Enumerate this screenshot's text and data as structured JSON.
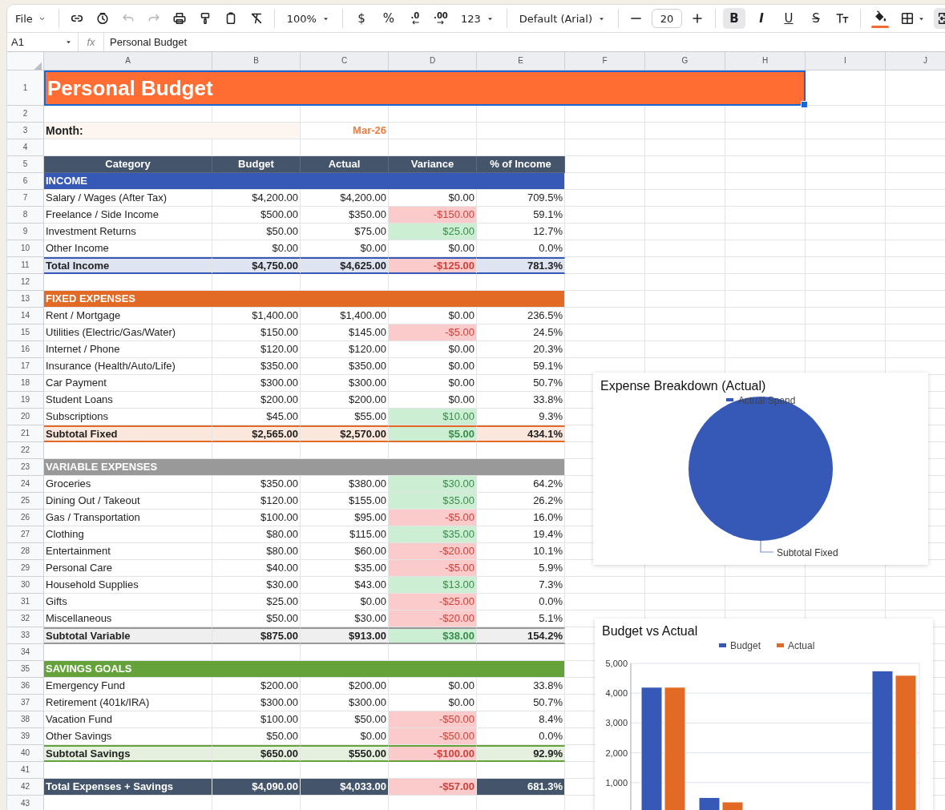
{
  "toolbar": [
    [
      {
        "kind": "file-menu",
        "label": "File"
      }
    ],
    [
      {
        "kind": "link",
        "disabled": false
      },
      {
        "kind": "history",
        "disabled": false
      },
      {
        "kind": "undo",
        "disabled": true
      },
      {
        "kind": "redo",
        "disabled": true
      },
      {
        "kind": "print",
        "disabled": false
      },
      {
        "kind": "paint-format",
        "disabled": false
      },
      {
        "kind": "paste",
        "disabled": false
      },
      {
        "kind": "clear-format",
        "disabled": false
      }
    ],
    [
      {
        "kind": "dropdown",
        "label": "100%"
      }
    ],
    [
      {
        "kind": "text",
        "label": "$"
      },
      {
        "kind": "text",
        "label": "%"
      },
      {
        "kind": "decimal-decrease",
        "label": ".0"
      },
      {
        "kind": "decimal-increase",
        "label": ".00"
      },
      {
        "kind": "dropdown",
        "label": "123"
      }
    ],
    [
      {
        "kind": "dropdown",
        "label": "Default (Arial)"
      }
    ],
    [
      {
        "kind": "minus"
      },
      {
        "kind": "field",
        "value": "20"
      },
      {
        "kind": "plus"
      }
    ],
    [
      {
        "kind": "bold",
        "label": "B",
        "selected": true
      },
      {
        "kind": "italic",
        "label": "I",
        "selected": false
      },
      {
        "kind": "underline",
        "label": "U",
        "selected": false
      },
      {
        "kind": "strike",
        "label": "S",
        "selected": false
      },
      {
        "kind": "text-size",
        "selected": false
      }
    ],
    [
      {
        "kind": "fill",
        "color": "#f26b2e",
        "selected": false
      },
      {
        "kind": "borders",
        "selected": false
      },
      {
        "kind": "merge",
        "selected": true
      }
    ]
  ],
  "formula_bar": {
    "cell_ref": "A1",
    "fx": "fx",
    "content": "Personal Budget"
  },
  "columns": [
    "A",
    "B",
    "C",
    "D",
    "E",
    "F",
    "G",
    "H",
    "I",
    "J"
  ],
  "rows": [
    {
      "kind": "title",
      "number": "1",
      "text": "Personal Budget",
      "selected": true
    },
    {
      "kind": "blank",
      "number": "2"
    },
    {
      "kind": "month",
      "number": "3",
      "label": "Month:",
      "value": "Mar-26"
    },
    {
      "kind": "blank",
      "number": "4"
    },
    {
      "kind": "header",
      "number": "5",
      "cells": [
        "Category",
        "Budget",
        "Actual",
        "Variance",
        "% of Income"
      ]
    },
    {
      "kind": "section",
      "number": "6",
      "label": "INCOME",
      "color": "#3659b7"
    },
    {
      "kind": "item",
      "number": "7",
      "category": "Salary / Wages (After Tax)",
      "budget": "$4,200.00",
      "actual": "$4,200.00",
      "variance": "$0.00",
      "negative": false,
      "positive": false,
      "percent": "709.5%"
    },
    {
      "kind": "item",
      "number": "8",
      "category": "Freelance / Side Income",
      "budget": "$500.00",
      "actual": "$350.00",
      "variance": "-$150.00",
      "negative": true,
      "positive": false,
      "percent": "59.1%"
    },
    {
      "kind": "item",
      "number": "9",
      "category": "Investment Returns",
      "budget": "$50.00",
      "actual": "$75.00",
      "variance": "$25.00",
      "negative": false,
      "positive": true,
      "percent": "12.7%"
    },
    {
      "kind": "item",
      "number": "10",
      "category": "Other Income",
      "budget": "$0.00",
      "actual": "$0.00",
      "variance": "$0.00",
      "negative": false,
      "positive": false,
      "percent": "0.0%"
    },
    {
      "kind": "total",
      "number": "11",
      "category": "Total Income",
      "budget": "$4,750.00",
      "actual": "$4,625.00",
      "variance": "-$125.00",
      "negative": true,
      "positive": false,
      "percent": "781.3%",
      "color": "#3659b7"
    },
    {
      "kind": "blank",
      "number": "12"
    },
    {
      "kind": "section",
      "number": "13",
      "label": "FIXED EXPENSES",
      "color": "#e36a25"
    },
    {
      "kind": "item",
      "number": "14",
      "category": "Rent / Mortgage",
      "budget": "$1,400.00",
      "actual": "$1,400.00",
      "variance": "$0.00",
      "negative": false,
      "positive": false,
      "percent": "236.5%"
    },
    {
      "kind": "item",
      "number": "15",
      "category": "Utilities (Electric/Gas/Water)",
      "budget": "$150.00",
      "actual": "$145.00",
      "variance": "-$5.00",
      "negative": true,
      "positive": false,
      "percent": "24.5%"
    },
    {
      "kind": "item",
      "number": "16",
      "category": "Internet / Phone",
      "budget": "$120.00",
      "actual": "$120.00",
      "variance": "$0.00",
      "negative": false,
      "positive": false,
      "percent": "20.3%"
    },
    {
      "kind": "item",
      "number": "17",
      "category": "Insurance (Health/Auto/Life)",
      "budget": "$350.00",
      "actual": "$350.00",
      "variance": "$0.00",
      "negative": false,
      "positive": false,
      "percent": "59.1%"
    },
    {
      "kind": "item",
      "number": "18",
      "category": "Car Payment",
      "budget": "$300.00",
      "actual": "$300.00",
      "variance": "$0.00",
      "negative": false,
      "positive": false,
      "percent": "50.7%"
    },
    {
      "kind": "item",
      "number": "19",
      "category": "Student Loans",
      "budget": "$200.00",
      "actual": "$200.00",
      "variance": "$0.00",
      "negative": false,
      "positive": false,
      "percent": "33.8%"
    },
    {
      "kind": "item",
      "number": "20",
      "category": "Subscriptions",
      "budget": "$45.00",
      "actual": "$55.00",
      "variance": "$10.00",
      "negative": false,
      "positive": true,
      "percent": "9.3%"
    },
    {
      "kind": "total",
      "number": "21",
      "category": "Subtotal Fixed",
      "budget": "$2,565.00",
      "actual": "$2,570.00",
      "variance": "$5.00",
      "negative": false,
      "positive": true,
      "percent": "434.1%",
      "color": "#e36a25"
    },
    {
      "kind": "blank",
      "number": "22"
    },
    {
      "kind": "section",
      "number": "23",
      "label": "VARIABLE EXPENSES",
      "color": "#999999"
    },
    {
      "kind": "item",
      "number": "24",
      "category": "Groceries",
      "budget": "$350.00",
      "actual": "$380.00",
      "variance": "$30.00",
      "negative": false,
      "positive": true,
      "percent": "64.2%"
    },
    {
      "kind": "item",
      "number": "25",
      "category": "Dining Out / Takeout",
      "budget": "$120.00",
      "actual": "$155.00",
      "variance": "$35.00",
      "negative": false,
      "positive": true,
      "percent": "26.2%"
    },
    {
      "kind": "item",
      "number": "26",
      "category": "Gas / Transportation",
      "budget": "$100.00",
      "actual": "$95.00",
      "variance": "-$5.00",
      "negative": true,
      "positive": false,
      "percent": "16.0%"
    },
    {
      "kind": "item",
      "number": "27",
      "category": "Clothing",
      "budget": "$80.00",
      "actual": "$115.00",
      "variance": "$35.00",
      "negative": false,
      "positive": true,
      "percent": "19.4%"
    },
    {
      "kind": "item",
      "number": "28",
      "category": "Entertainment",
      "budget": "$80.00",
      "actual": "$60.00",
      "variance": "-$20.00",
      "negative": true,
      "positive": false,
      "percent": "10.1%"
    },
    {
      "kind": "item",
      "number": "29",
      "category": "Personal Care",
      "budget": "$40.00",
      "actual": "$35.00",
      "variance": "-$5.00",
      "negative": true,
      "positive": false,
      "percent": "5.9%"
    },
    {
      "kind": "item",
      "number": "30",
      "category": "Household Supplies",
      "budget": "$30.00",
      "actual": "$43.00",
      "variance": "$13.00",
      "negative": false,
      "positive": true,
      "percent": "7.3%"
    },
    {
      "kind": "item",
      "number": "31",
      "category": "Gifts",
      "budget": "$25.00",
      "actual": "$0.00",
      "variance": "-$25.00",
      "negative": true,
      "positive": false,
      "percent": "0.0%"
    },
    {
      "kind": "item",
      "number": "32",
      "category": "Miscellaneous",
      "budget": "$50.00",
      "actual": "$30.00",
      "variance": "-$20.00",
      "negative": true,
      "positive": false,
      "percent": "5.1%"
    },
    {
      "kind": "total",
      "number": "33",
      "category": "Subtotal Variable",
      "budget": "$875.00",
      "actual": "$913.00",
      "variance": "$38.00",
      "negative": false,
      "positive": true,
      "percent": "154.2%",
      "color": "#999999"
    },
    {
      "kind": "blank",
      "number": "34"
    },
    {
      "kind": "section",
      "number": "35",
      "label": "SAVINGS GOALS",
      "color": "#65a33a"
    },
    {
      "kind": "item",
      "number": "36",
      "category": "Emergency Fund",
      "budget": "$200.00",
      "actual": "$200.00",
      "variance": "$0.00",
      "negative": false,
      "positive": false,
      "percent": "33.8%"
    },
    {
      "kind": "item",
      "number": "37",
      "category": "Retirement (401k/IRA)",
      "budget": "$300.00",
      "actual": "$300.00",
      "variance": "$0.00",
      "negative": false,
      "positive": false,
      "percent": "50.7%"
    },
    {
      "kind": "item",
      "number": "38",
      "category": "Vacation Fund",
      "budget": "$100.00",
      "actual": "$50.00",
      "variance": "-$50.00",
      "negative": true,
      "positive": false,
      "percent": "8.4%"
    },
    {
      "kind": "item",
      "number": "39",
      "category": "Other Savings",
      "budget": "$50.00",
      "actual": "$0.00",
      "variance": "-$50.00",
      "negative": true,
      "positive": false,
      "percent": "0.0%"
    },
    {
      "kind": "total",
      "number": "40",
      "category": "Subtotal Savings",
      "budget": "$650.00",
      "actual": "$550.00",
      "variance": "-$100.00",
      "negative": true,
      "positive": false,
      "percent": "92.9%",
      "color": "#65a33a"
    },
    {
      "kind": "blank",
      "number": "41"
    },
    {
      "kind": "grand_total",
      "number": "42",
      "category": "Total Expenses + Savings",
      "budget": "$4,090.00",
      "actual": "$4,033.00",
      "variance": "-$57.00",
      "negative": true,
      "positive": false,
      "percent": "681.3%",
      "color": "#44546a"
    },
    {
      "kind": "blank",
      "number": "43"
    }
  ],
  "charts": [
    {
      "chart_data": {
        "type": "pie",
        "title": "Expense Breakdown (Actual)",
        "legend": true,
        "categories": [
          "Subtotal Fixed"
        ],
        "series": [
          {
            "name": "Actual Spend",
            "color": "#3659b7",
            "values": [
              100
            ]
          }
        ]
      }
    },
    {
      "chart_data": {
        "type": "bar",
        "title": "Budget vs Actual",
        "legend": true,
        "grid": true,
        "ylim": [
          0,
          5000
        ],
        "yticks": [
          {
            "value": 1000,
            "label": "1,000"
          },
          {
            "value": 2000,
            "label": "2,000"
          },
          {
            "value": 3000,
            "label": "3,000"
          },
          {
            "value": 4000,
            "label": "4,000"
          },
          {
            "value": 5000,
            "label": "5,000"
          }
        ],
        "series": [
          {
            "name": "Budget",
            "color": "#3659b7",
            "values": [
              4200,
              500,
              null,
              null,
              4750
            ]
          },
          {
            "name": "Actual",
            "color": "#e36a25",
            "values": [
              4200,
              350,
              null,
              null,
              4600
            ]
          }
        ]
      }
    }
  ]
}
